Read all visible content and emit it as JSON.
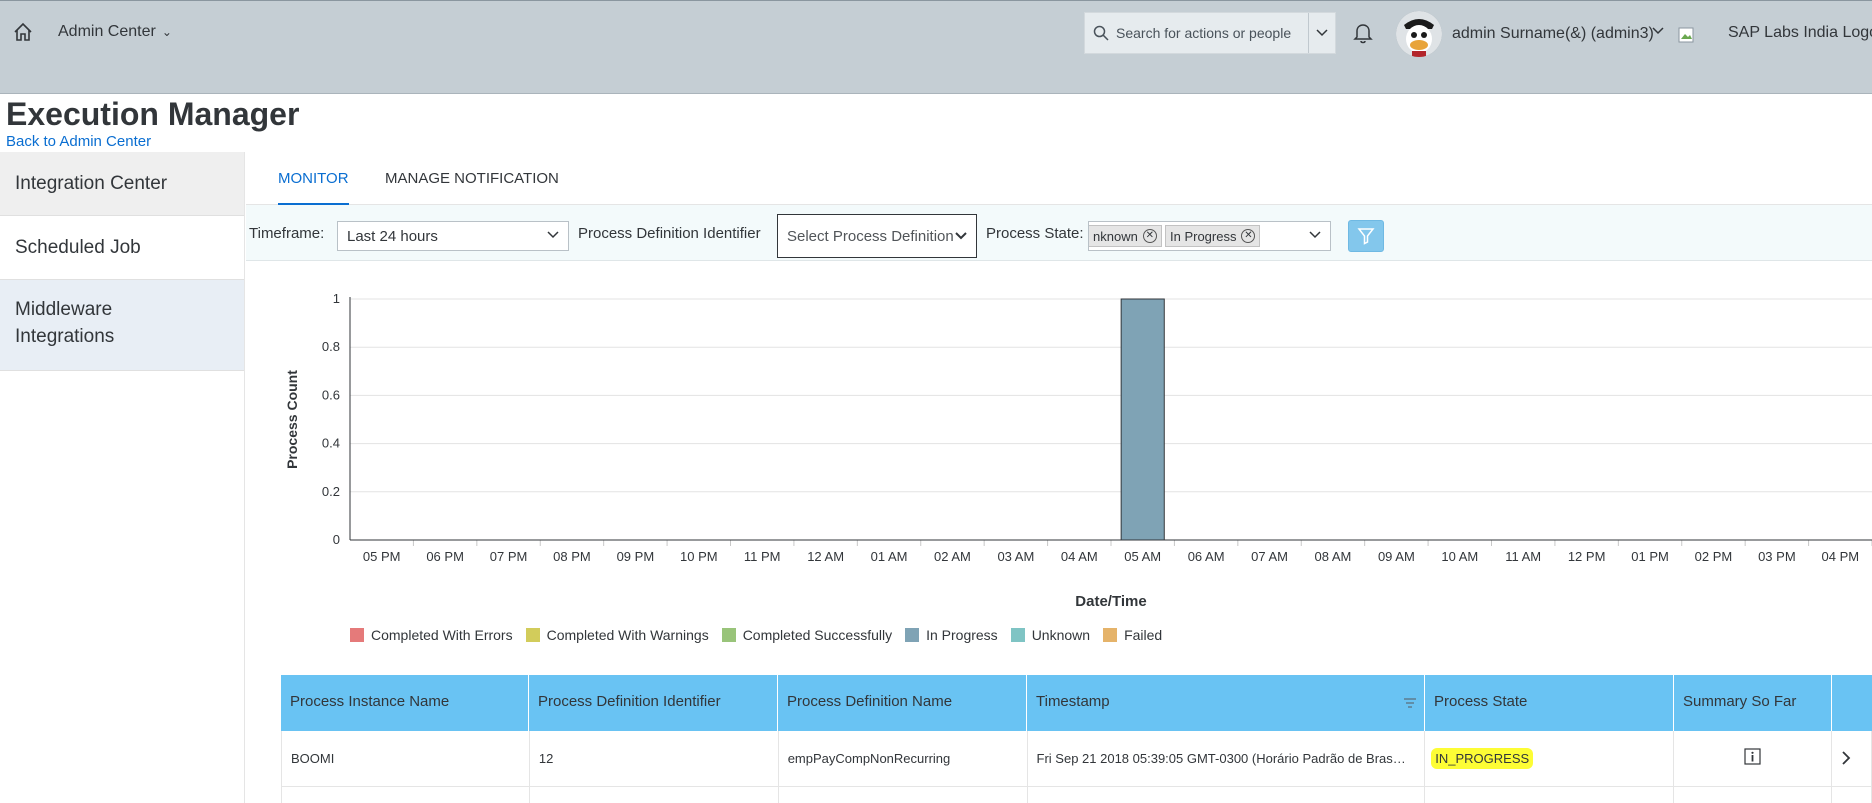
{
  "shell": {
    "title": "Admin Center",
    "search_placeholder": "Search for actions or people",
    "user_name": "admin Surname(&) (admin3)",
    "company_logo_alt": "SAP Labs India Logo"
  },
  "page": {
    "title": "Execution Manager",
    "back_link": "Back to Admin Center"
  },
  "leftnav": {
    "items": [
      {
        "label": "Integration Center"
      },
      {
        "label": "Scheduled Job"
      },
      {
        "label": "Middleware Integrations"
      }
    ]
  },
  "tabs": [
    {
      "label": "MONITOR",
      "active": true
    },
    {
      "label": "MANAGE NOTIFICATION",
      "active": false
    }
  ],
  "filters": {
    "timeframe_label": "Timeframe:",
    "timeframe_value": "Last 24 hours",
    "pdi_label": "Process Definition Identifier",
    "pdi_placeholder": "Select Process Definition I",
    "state_label": "Process State:",
    "state_tokens": [
      "nknown",
      "In Progress"
    ]
  },
  "chart_data": {
    "type": "bar",
    "xlabel": "Date/Time",
    "ylabel": "Process Count",
    "ylim": [
      0,
      1
    ],
    "yticks": [
      "0",
      "0.2",
      "0.4",
      "0.6",
      "0.8",
      "1"
    ],
    "categories": [
      "05 PM",
      "06 PM",
      "07 PM",
      "08 PM",
      "09 PM",
      "10 PM",
      "11 PM",
      "12 AM",
      "01 AM",
      "02 AM",
      "03 AM",
      "04 AM",
      "05 AM",
      "06 AM",
      "07 AM",
      "08 AM",
      "09 AM",
      "10 AM",
      "11 AM",
      "12 PM",
      "01 PM",
      "02 PM",
      "03 PM",
      "04 PM"
    ],
    "series": [
      {
        "name": "In Progress",
        "color": "#7fa3b5",
        "values": [
          0,
          0,
          0,
          0,
          0,
          0,
          0,
          0,
          0,
          0,
          0,
          0,
          1,
          0,
          0,
          0,
          0,
          0,
          0,
          0,
          0,
          0,
          0,
          0
        ]
      }
    ],
    "legend": [
      {
        "label": "Completed With Errors",
        "color": "#e57a7a"
      },
      {
        "label": "Completed With Warnings",
        "color": "#d2cc5b"
      },
      {
        "label": "Completed Successfully",
        "color": "#99c47a"
      },
      {
        "label": "In Progress",
        "color": "#7fa3b5"
      },
      {
        "label": "Unknown",
        "color": "#7fc4c4"
      },
      {
        "label": "Failed",
        "color": "#e5b36a"
      }
    ],
    "grid": true,
    "legend_placement": "bottom"
  },
  "table": {
    "columns": [
      "Process Instance Name",
      "Process Definition Identifier",
      "Process Definition Name",
      "Timestamp",
      "Process State",
      "Summary So Far"
    ],
    "rows": [
      [
        "BOOMI",
        "12",
        "empPayCompNonRecurring",
        "Fri Sep 21 2018 05:39:05 GMT-0300 (Horário Padrão de Bras…",
        "IN_PROGRESS"
      ]
    ]
  },
  "colors": {
    "accent": "#0a6ed1",
    "table_header": "#69c3f3",
    "highlight": "#fdfd35"
  }
}
